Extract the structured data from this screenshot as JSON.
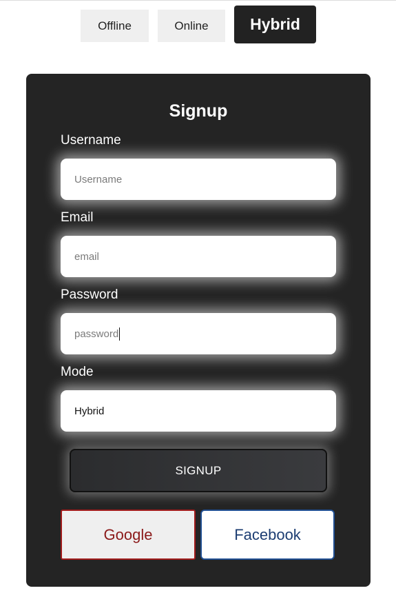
{
  "mode_tabs": {
    "offline": "Offline",
    "online": "Online",
    "hybrid": "Hybrid",
    "active": "Hybrid"
  },
  "form": {
    "title": "Signup",
    "username": {
      "label": "Username",
      "placeholder": "Username",
      "value": ""
    },
    "email": {
      "label": "Email",
      "placeholder": "email",
      "value": ""
    },
    "password": {
      "label": "Password",
      "placeholder": "password",
      "value": ""
    },
    "mode": {
      "label": "Mode",
      "value": "Hybrid"
    },
    "submit_label": "SIGNUP"
  },
  "social": {
    "google_label": "Google",
    "facebook_label": "Facebook"
  },
  "colors": {
    "card_bg": "#242424",
    "active_tab_bg": "#222222",
    "google_text": "#8b1a1a",
    "facebook_text": "#1c3d72"
  }
}
